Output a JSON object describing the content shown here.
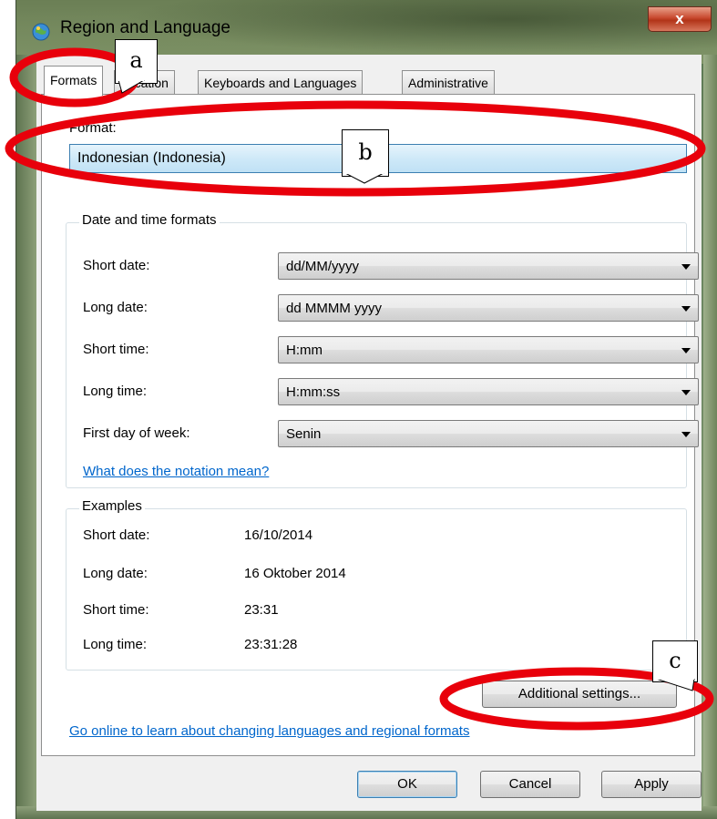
{
  "window": {
    "title": "Region and Language",
    "close_label": "x"
  },
  "tabs": [
    {
      "label": "Formats",
      "active": true
    },
    {
      "label": "Location",
      "active": false
    },
    {
      "label": "Keyboards and Languages",
      "active": false
    },
    {
      "label": "Administrative",
      "active": false
    }
  ],
  "format": {
    "label": "Format:",
    "value": "Indonesian (Indonesia)"
  },
  "date_time_formats": {
    "title": "Date and time formats",
    "rows": [
      {
        "label": "Short date:",
        "value": "dd/MM/yyyy"
      },
      {
        "label": "Long date:",
        "value": "dd MMMM yyyy"
      },
      {
        "label": "Short time:",
        "value": "H:mm"
      },
      {
        "label": "Long time:",
        "value": "H:mm:ss"
      },
      {
        "label": "First day of week:",
        "value": "Senin"
      }
    ],
    "notation_link": "What does the notation mean?"
  },
  "examples": {
    "title": "Examples",
    "rows": [
      {
        "label": "Short date:",
        "value": "16/10/2014"
      },
      {
        "label": "Long date:",
        "value": "16 Oktober 2014"
      },
      {
        "label": "Short time:",
        "value": "23:31"
      },
      {
        "label": "Long time:",
        "value": "23:31:28"
      }
    ]
  },
  "additional_settings_label": "Additional settings...",
  "online_link": "Go online to learn about changing languages and regional formats",
  "buttons": {
    "ok": "OK",
    "cancel": "Cancel",
    "apply": "Apply"
  },
  "annotations": {
    "a": "a",
    "b": "b",
    "c": "c",
    "ellipse_color": "#e8000b"
  }
}
